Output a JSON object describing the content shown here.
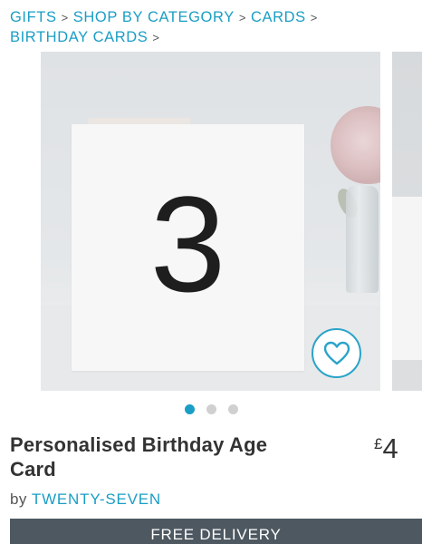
{
  "breadcrumb": {
    "items": [
      {
        "label": "GIFTS"
      },
      {
        "label": "SHOP BY CATEGORY"
      },
      {
        "label": "CARDS"
      },
      {
        "label": "BIRTHDAY CARDS"
      }
    ],
    "separator": ">"
  },
  "gallery": {
    "card_number": "3",
    "active_slide": 1,
    "slide_count": 3
  },
  "product": {
    "title": "Personalised Birthday Age Card",
    "price_currency": "£",
    "price_amount": "4",
    "seller_prefix": "by",
    "seller_name": "TWENTY-SEVEN"
  },
  "delivery": {
    "label": "FREE DELIVERY"
  },
  "colors": {
    "accent": "#1a9ec5",
    "text": "#333333",
    "bar": "#4d5861"
  },
  "icons": {
    "wishlist": "heart-icon"
  }
}
